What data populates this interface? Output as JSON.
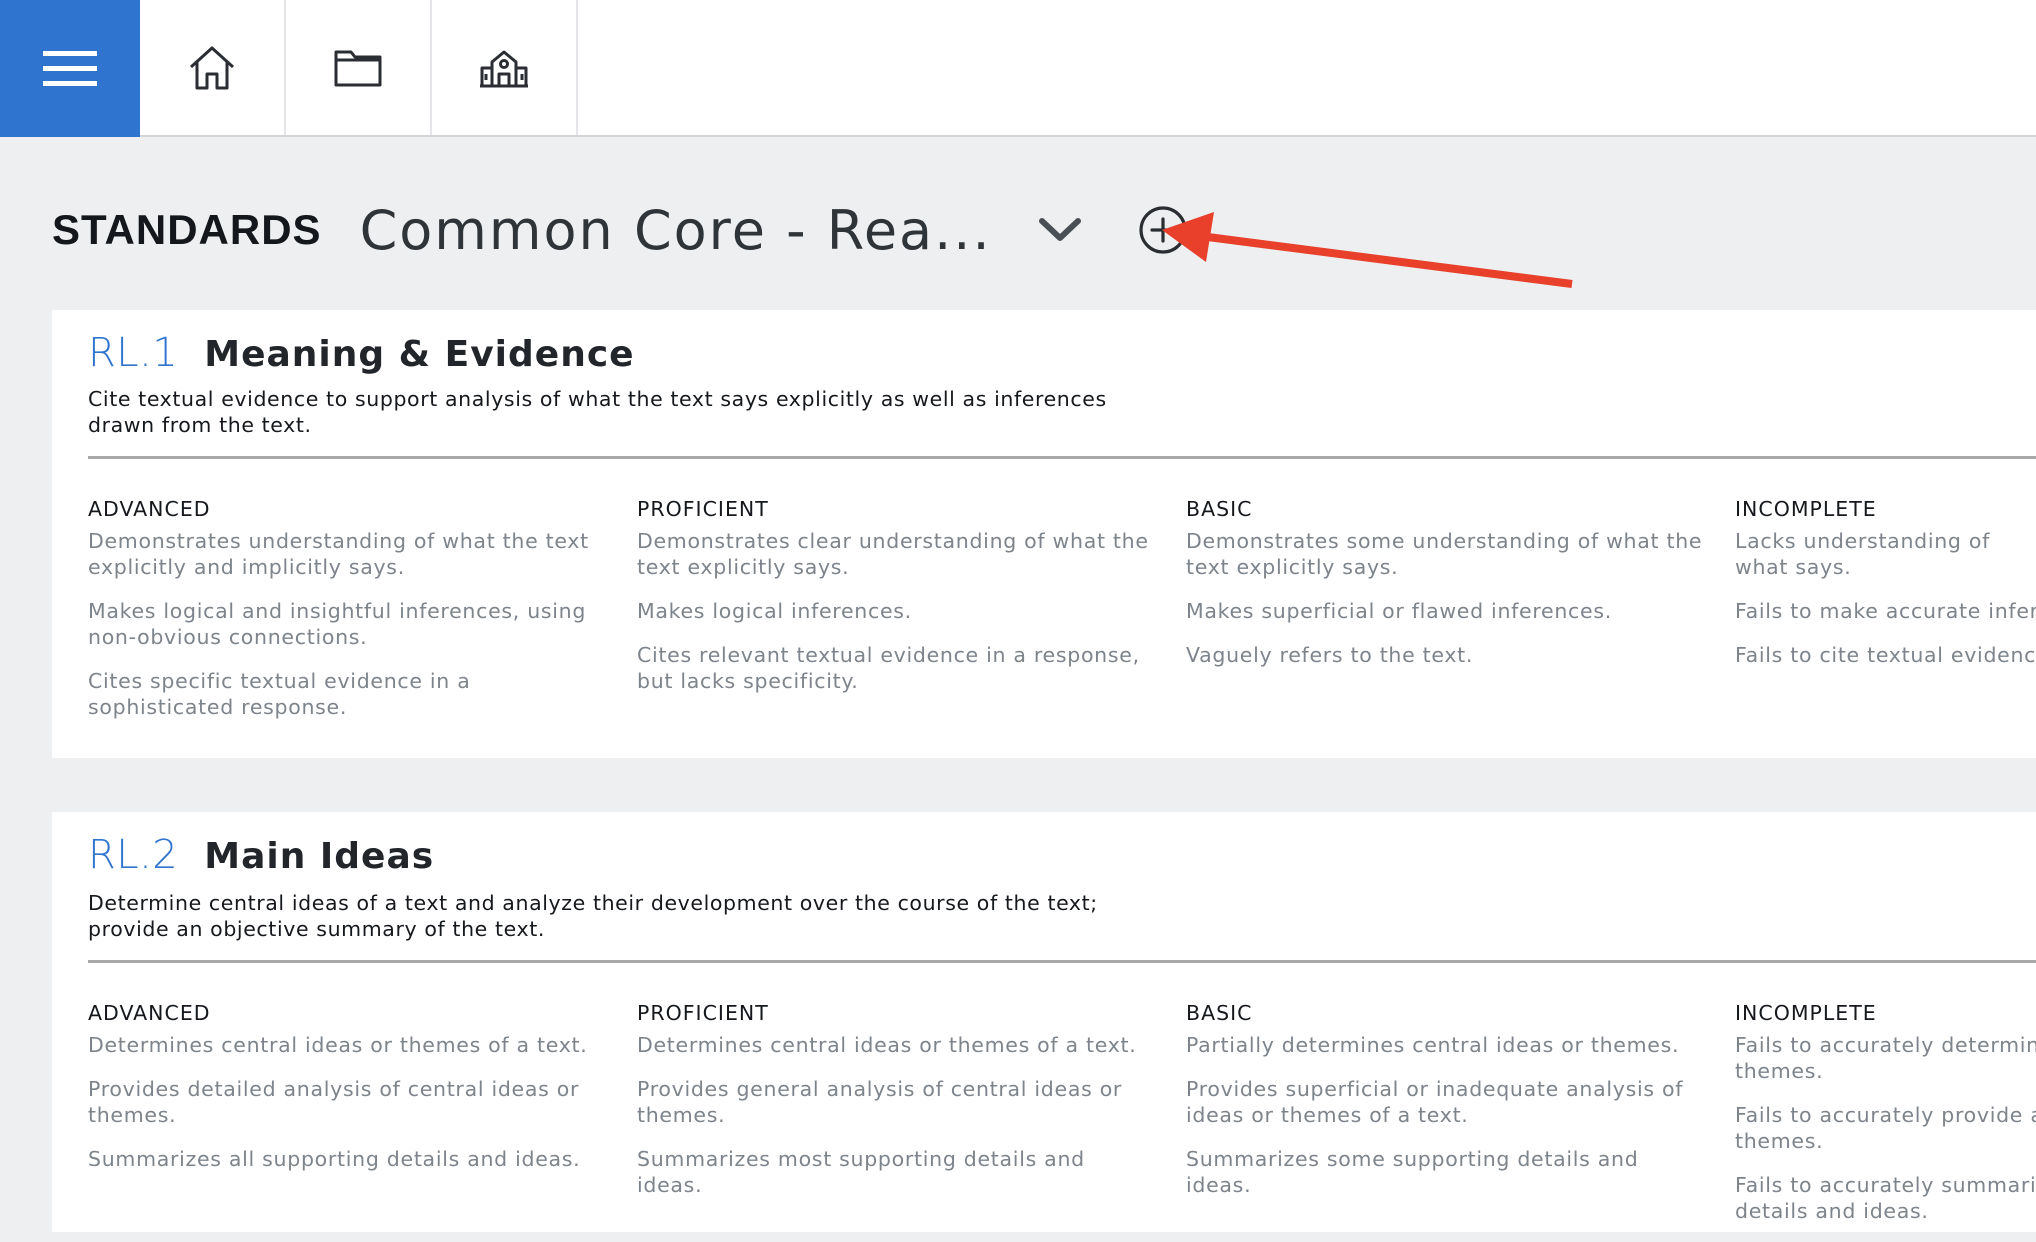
{
  "nav": {
    "items": [
      {
        "name": "menu",
        "icon": "hamburger-menu-icon"
      },
      {
        "name": "home",
        "icon": "home-icon"
      },
      {
        "name": "folder",
        "icon": "folder-icon"
      },
      {
        "name": "school",
        "icon": "school-building-icon"
      }
    ],
    "accent_color": "#2f74cf"
  },
  "header": {
    "label": "STANDARDS",
    "selected_standard": "Common Core - Rea...",
    "dropdown_icon": "chevron-down-icon",
    "add_icon": "plus-circle-icon",
    "annotation": "red-arrow-pointing-to-add"
  },
  "standards": [
    {
      "code": "RL.1",
      "title": "Meaning & Evidence",
      "description_lines": [
        "Cite textual evidence to support analysis of what the text says explicitly as well as inferences",
        "drawn from the text."
      ],
      "levels": [
        {
          "label": "ADVANCED",
          "items": [
            "Demonstrates understanding of what the text explicitly and implicitly says.",
            "Makes logical and insightful inferences, using non-obvious connections.",
            "Cites specific textual evidence in a sophisticated response."
          ]
        },
        {
          "label": "PROFICIENT",
          "items": [
            "Demonstrates clear understanding of what the text explicitly says.",
            "Makes logical inferences.",
            "Cites relevant textual evidence in a response, but lacks specificity."
          ]
        },
        {
          "label": "BASIC",
          "items": [
            "Demonstrates some understanding of what the text explicitly says.",
            "Makes superficial or flawed inferences.",
            "Vaguely refers to the text."
          ]
        },
        {
          "label": "INCOMPLETE",
          "items": [
            "Lacks understanding of what says.",
            "Fails to make accurate infere",
            "Fails to cite textual evidence"
          ]
        }
      ]
    },
    {
      "code": "RL.2",
      "title": "Main Ideas",
      "description_lines": [
        "Determine central ideas of a text and analyze their development over the course of the text;",
        "provide an objective summary of the text."
      ],
      "levels": [
        {
          "label": "ADVANCED",
          "items": [
            "Determines central ideas or themes of a text.",
            "Provides detailed analysis of central ideas or themes.",
            "Summarizes all supporting details and ideas."
          ]
        },
        {
          "label": "PROFICIENT",
          "items": [
            "Determines central ideas or themes of a text.",
            "Provides general analysis of central ideas or themes.",
            "Summarizes most supporting details and ideas."
          ]
        },
        {
          "label": "BASIC",
          "items": [
            "Partially determines central ideas or themes.",
            "Provides superficial or inadequate analysis of ideas or themes of a text.",
            "Summarizes some supporting details and ideas."
          ]
        },
        {
          "label": "INCOMPLETE",
          "items": [
            "Fails to accurately determine themes.",
            "Fails to accurately provide an themes.",
            "Fails to accurately summariz details and ideas."
          ]
        }
      ]
    }
  ]
}
